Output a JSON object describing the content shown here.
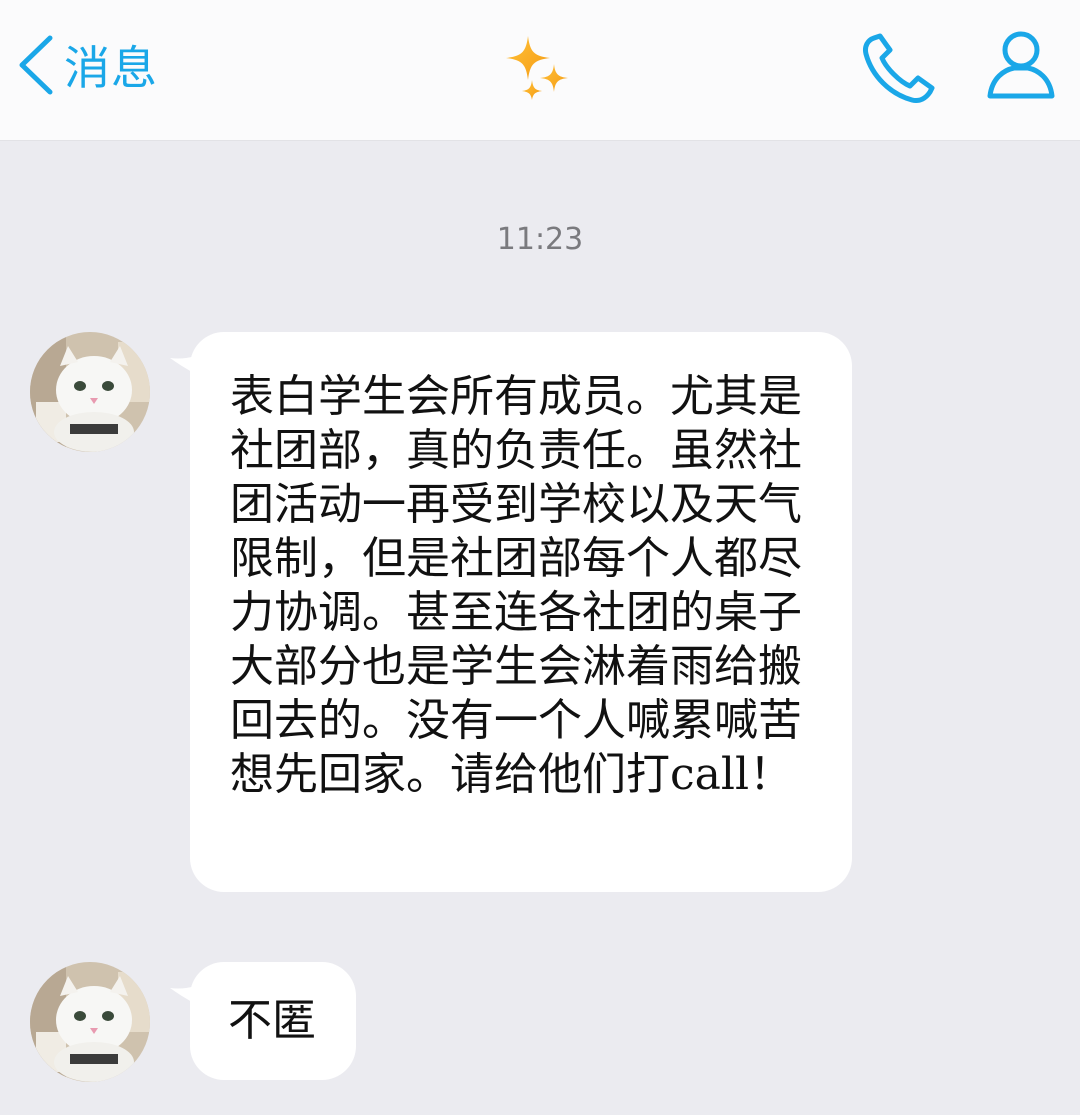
{
  "navbar": {
    "back_label": "消息",
    "accent_color": "#1aa7e8",
    "center_icon": "sparkle-icon",
    "right_icons": [
      "phone-icon",
      "profile-icon"
    ]
  },
  "conversation": {
    "timestamp": "11:23",
    "messages": [
      {
        "sender": "other",
        "avatar": "cat-avatar",
        "text": "表白学生会所有成员。尤其是社团部，真的负责任。虽然社团活动一再受到学校以及天气限制，但是社团部每个人都尽力协调。甚至连各社团的桌子大部分也是学生会淋着雨给搬回去的。没有一个人喊累喊苦想先回家。请给他们打call！"
      },
      {
        "sender": "other",
        "avatar": "cat-avatar",
        "text": "不匿"
      }
    ]
  }
}
